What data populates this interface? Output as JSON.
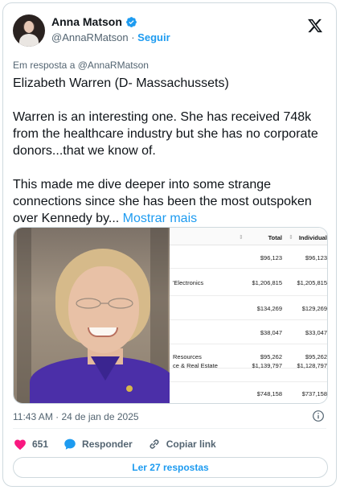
{
  "author": {
    "name": "Anna Matson",
    "handle": "@AnnaRMatson",
    "separator": "·",
    "follow_label": "Seguir"
  },
  "reply_context": "Em resposta a @AnnaRMatson",
  "tweet": {
    "text": "Elizabeth Warren (D- Massachussets)\n\nWarren is an interesting one. She has received 748k from the healthcare industry but she has no corporate donors...that we know of.\n\nThis made me dive deeper into some strange connections since she has been the most outspoken over Kennedy by... ",
    "show_more": "Mostrar mais"
  },
  "media": {
    "table": {
      "headers": [
        "Total",
        "Individuals"
      ],
      "rows": [
        {
          "label": "",
          "total": "$96,123",
          "individuals": "$96,123"
        },
        {
          "label": "'Electronics",
          "total": "$1,206,815",
          "individuals": "$1,205,815"
        },
        {
          "label": "",
          "total": "$134,269",
          "individuals": "$129,269"
        },
        {
          "label": "",
          "total": "$38,047",
          "individuals": "$33,047"
        },
        {
          "label": "Resources",
          "total": "$95,262",
          "individuals": "$95,262"
        },
        {
          "label": "ce & Real Estate",
          "total": "$1,139,797",
          "individuals": "$1,128,797"
        },
        {
          "label": "",
          "total": "$748,158",
          "individuals": "$737,158"
        }
      ]
    }
  },
  "timestamp": "11:43 AM · 24 de jan de 2025",
  "actions": {
    "like_count": "651",
    "reply_label": "Responder",
    "copy_label": "Copiar link"
  },
  "replies_button": "Ler 27 respostas",
  "colors": {
    "accent": "#1d9bf0",
    "like": "#f91880",
    "text": "#0f1419",
    "muted": "#536471"
  },
  "icons": [
    "verified-badge-icon",
    "x-logo-icon",
    "info-icon",
    "heart-icon",
    "reply-bubble-icon",
    "link-icon"
  ]
}
